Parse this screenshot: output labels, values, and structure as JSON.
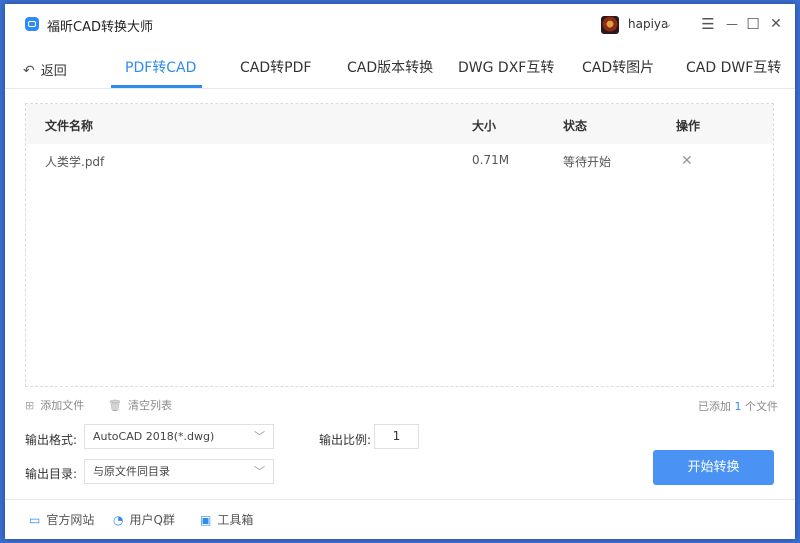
{
  "app": {
    "title": "福昕CAD转换大师",
    "username": "hapiya"
  },
  "window_controls": {
    "user_menu": "⌄",
    "menu": "☰",
    "minimize": "—",
    "maximize": "☐",
    "close": "✕"
  },
  "nav": {
    "back_label": "返回",
    "tabs": [
      {
        "label": "PDF转CAD",
        "active": true
      },
      {
        "label": "CAD转PDF"
      },
      {
        "label": "CAD版本转换"
      },
      {
        "label": "DWG DXF互转"
      },
      {
        "label": "CAD转图片"
      },
      {
        "label": "CAD DWF互转"
      }
    ]
  },
  "table": {
    "columns": [
      "文件名称",
      "大小",
      "状态",
      "操作"
    ],
    "rows": [
      {
        "name": "人类学.pdf",
        "size": "0.71M",
        "status": "等待开始",
        "action_icon": "close-icon"
      }
    ]
  },
  "toolbar": {
    "add_file": "添加文件",
    "clear_list": "清空列表",
    "count_prefix": "已添加",
    "count_value": "1",
    "count_suffix": "个文件"
  },
  "form": {
    "format_label": "输出格式:",
    "format_value": "AutoCAD 2018(*.dwg)",
    "ratio_label": "输出比例:",
    "ratio_value": "1",
    "dir_label": "输出目录:",
    "dir_value": "与原文件同目录"
  },
  "start_button": "开始转换",
  "footer": {
    "website": "官方网站",
    "qq_group": "用户Q群",
    "toolbox": "工具箱"
  },
  "colors": {
    "accent": "#2e8cf0",
    "button": "#4a92f4",
    "desktop": "#3a6fd1"
  }
}
